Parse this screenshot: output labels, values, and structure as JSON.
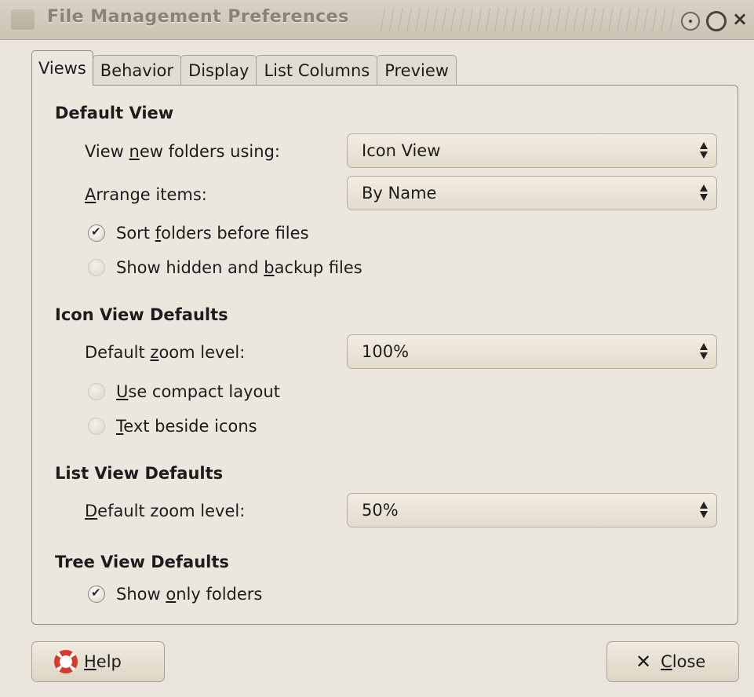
{
  "window": {
    "title": "File Management Preferences"
  },
  "tabs": [
    {
      "label": "Views",
      "active": true
    },
    {
      "label": "Behavior"
    },
    {
      "label": "Display"
    },
    {
      "label": "List Columns"
    },
    {
      "label": "Preview"
    }
  ],
  "default_view": {
    "title": "Default View",
    "view_label_pre": "View ",
    "view_label_u": "n",
    "view_label_post": "ew folders using:",
    "view_value": "Icon View",
    "arrange_label_u": "A",
    "arrange_label_post": "rrange items:",
    "arrange_value": "By Name",
    "sort_pre": "Sort ",
    "sort_u": "f",
    "sort_post": "olders before files",
    "sort_checked": true,
    "hidden_pre": "Show hidden and ",
    "hidden_u": "b",
    "hidden_post": "ackup files",
    "hidden_checked": false
  },
  "icon_view": {
    "title": "Icon View Defaults",
    "zoom_pre": "Default ",
    "zoom_u": "z",
    "zoom_post": "oom level:",
    "zoom_value": "100%",
    "compact_u": "U",
    "compact_post": "se compact layout",
    "compact_checked": false,
    "beside_u": "T",
    "beside_post": "ext beside icons",
    "beside_checked": false
  },
  "list_view": {
    "title": "List View Defaults",
    "zoom_u": "D",
    "zoom_post": "efault zoom level:",
    "zoom_value": "50%"
  },
  "tree_view": {
    "title": "Tree View Defaults",
    "folders_pre": "Show ",
    "folders_u": "o",
    "folders_post": "nly folders",
    "folders_checked": true
  },
  "buttons": {
    "help_u": "H",
    "help_post": "elp",
    "close_u": "C",
    "close_post": "lose"
  }
}
